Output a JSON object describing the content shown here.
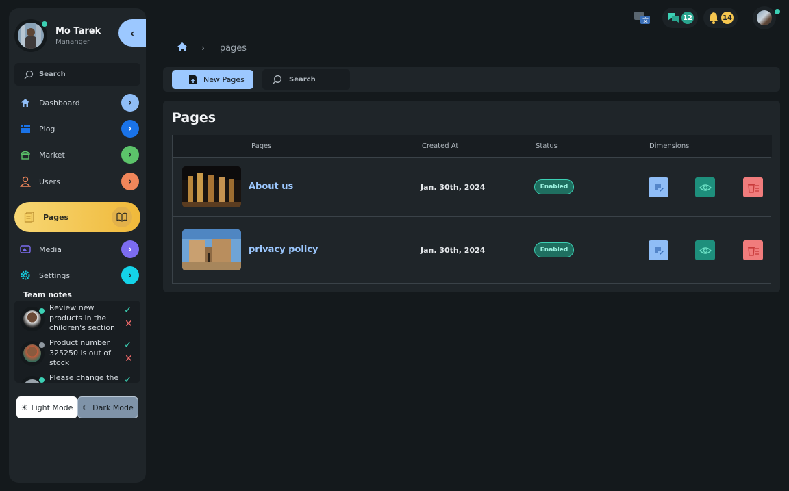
{
  "profile": {
    "name": "Mo Tarek",
    "role": "Mananger"
  },
  "sidebar": {
    "search_label": "Search",
    "items": [
      {
        "label": "Dashboard",
        "icon": "home-icon",
        "color": "#8fbdf6"
      },
      {
        "label": "Plog",
        "icon": "blog-icon",
        "color": "#1a73e8"
      },
      {
        "label": "Market",
        "icon": "market-icon",
        "color": "#5cc36a"
      },
      {
        "label": "Users",
        "icon": "user-icon",
        "color": "#f0865a"
      },
      {
        "label": "Pages",
        "icon": "pages-icon",
        "color": "#f5c64f"
      },
      {
        "label": "Media",
        "icon": "media-icon",
        "color": "#7c6cf0"
      },
      {
        "label": "Settings",
        "icon": "gear-icon",
        "color": "#14d3e8"
      }
    ]
  },
  "team_notes": {
    "title": "Team notes",
    "notes": [
      {
        "text": "Review new products in the children's section"
      },
      {
        "text": "Product number 325250 is out of stock"
      },
      {
        "text": "Please change the"
      }
    ]
  },
  "mode": {
    "light_label": "Light Mode",
    "dark_label": "Dark Mode"
  },
  "topbar": {
    "messages_count": "12",
    "notifications_count": "14"
  },
  "breadcrumb": {
    "current": "pages"
  },
  "toolbar": {
    "new_label": "New Pages",
    "search_label": "Search"
  },
  "panel": {
    "title": "Pages",
    "columns": [
      "Pages",
      "Created At",
      "Status",
      "Dimensions"
    ],
    "rows": [
      {
        "title": "About us",
        "created": "Jan. 30th, 2024",
        "status": "Enabled"
      },
      {
        "title": "privacy policy",
        "created": "Jan. 30th, 2024",
        "status": "Enabled"
      }
    ]
  },
  "colors": {
    "accent": "#9cc8ff",
    "success": "#3cd0b4",
    "danger": "#f07c7c",
    "warning": "#f5c64f"
  }
}
